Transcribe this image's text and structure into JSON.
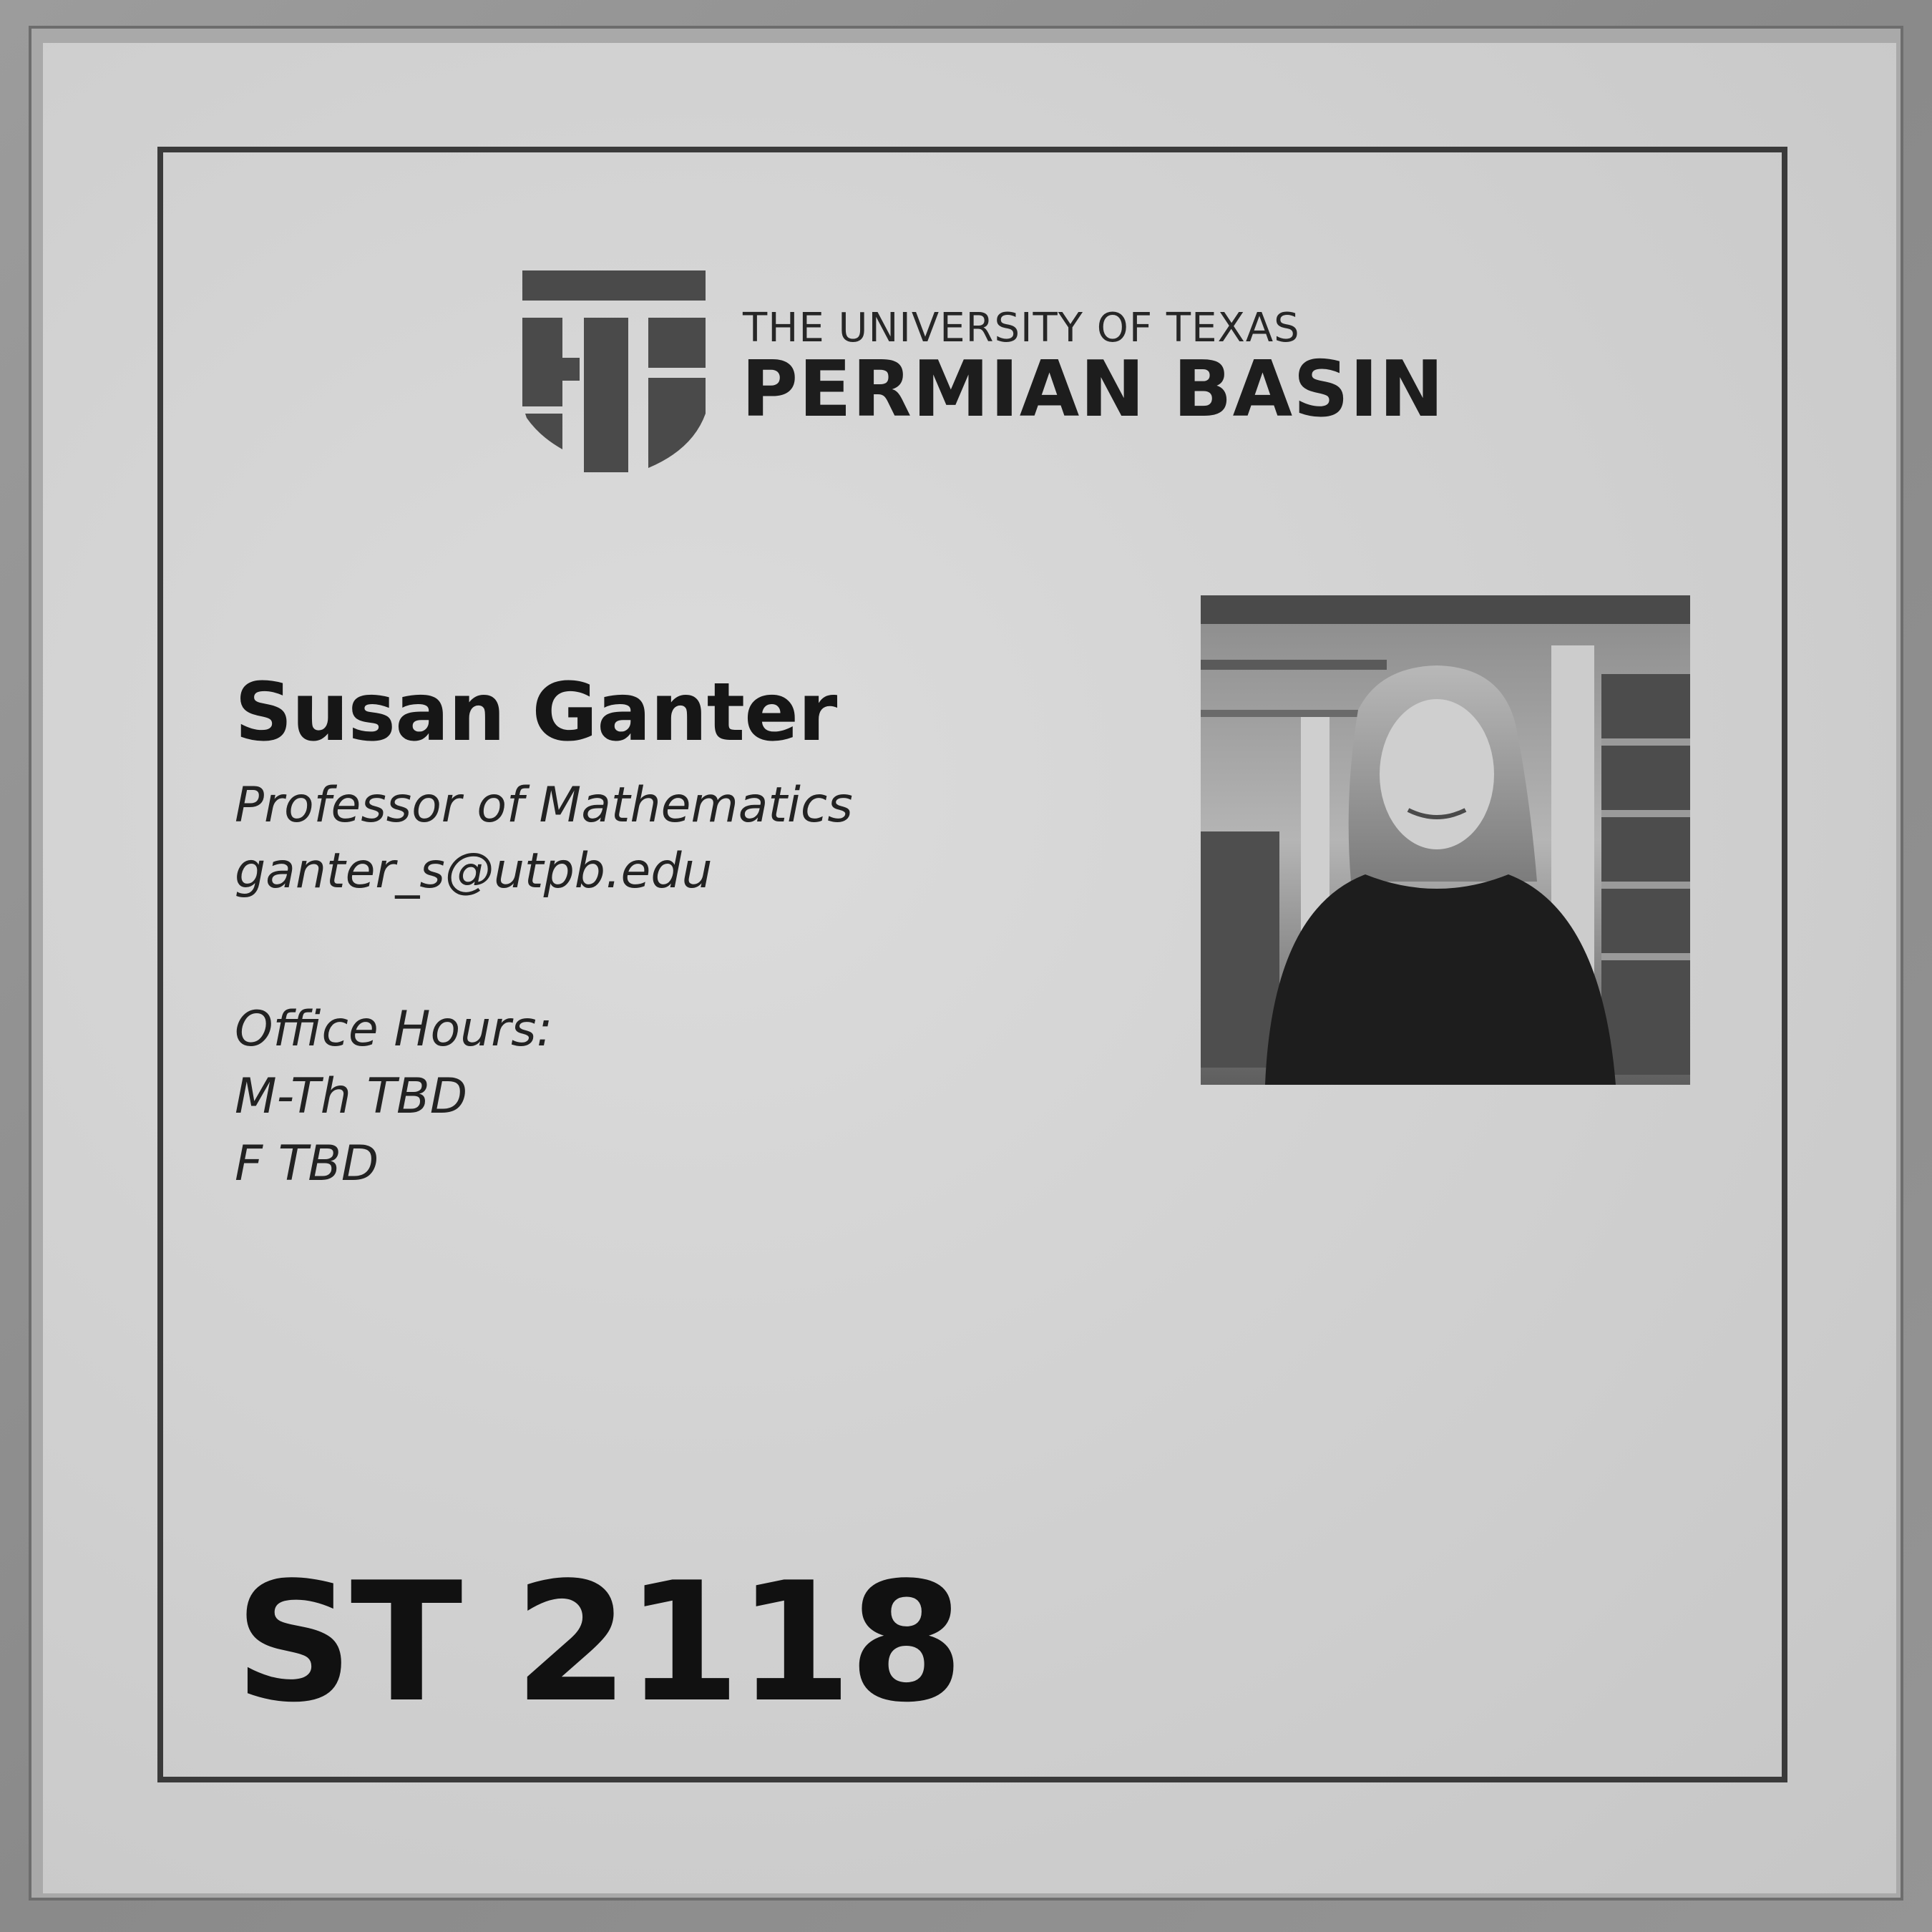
{
  "logo": {
    "line1": "THE UNIVERSITY OF TEXAS",
    "line2": "PERMIAN BASIN"
  },
  "person": {
    "name": "Susan Ganter",
    "title": "Professor of Mathematics",
    "email": "ganter_s@utpb.edu"
  },
  "office_hours": {
    "heading": "Office Hours:",
    "lines": [
      "M-Th TBD",
      "F TBD"
    ]
  },
  "room": "ST 2118",
  "colors": {
    "paper": "#d6d6d6",
    "ink": "#1a1a1a",
    "frame": "#9a9a9a"
  }
}
